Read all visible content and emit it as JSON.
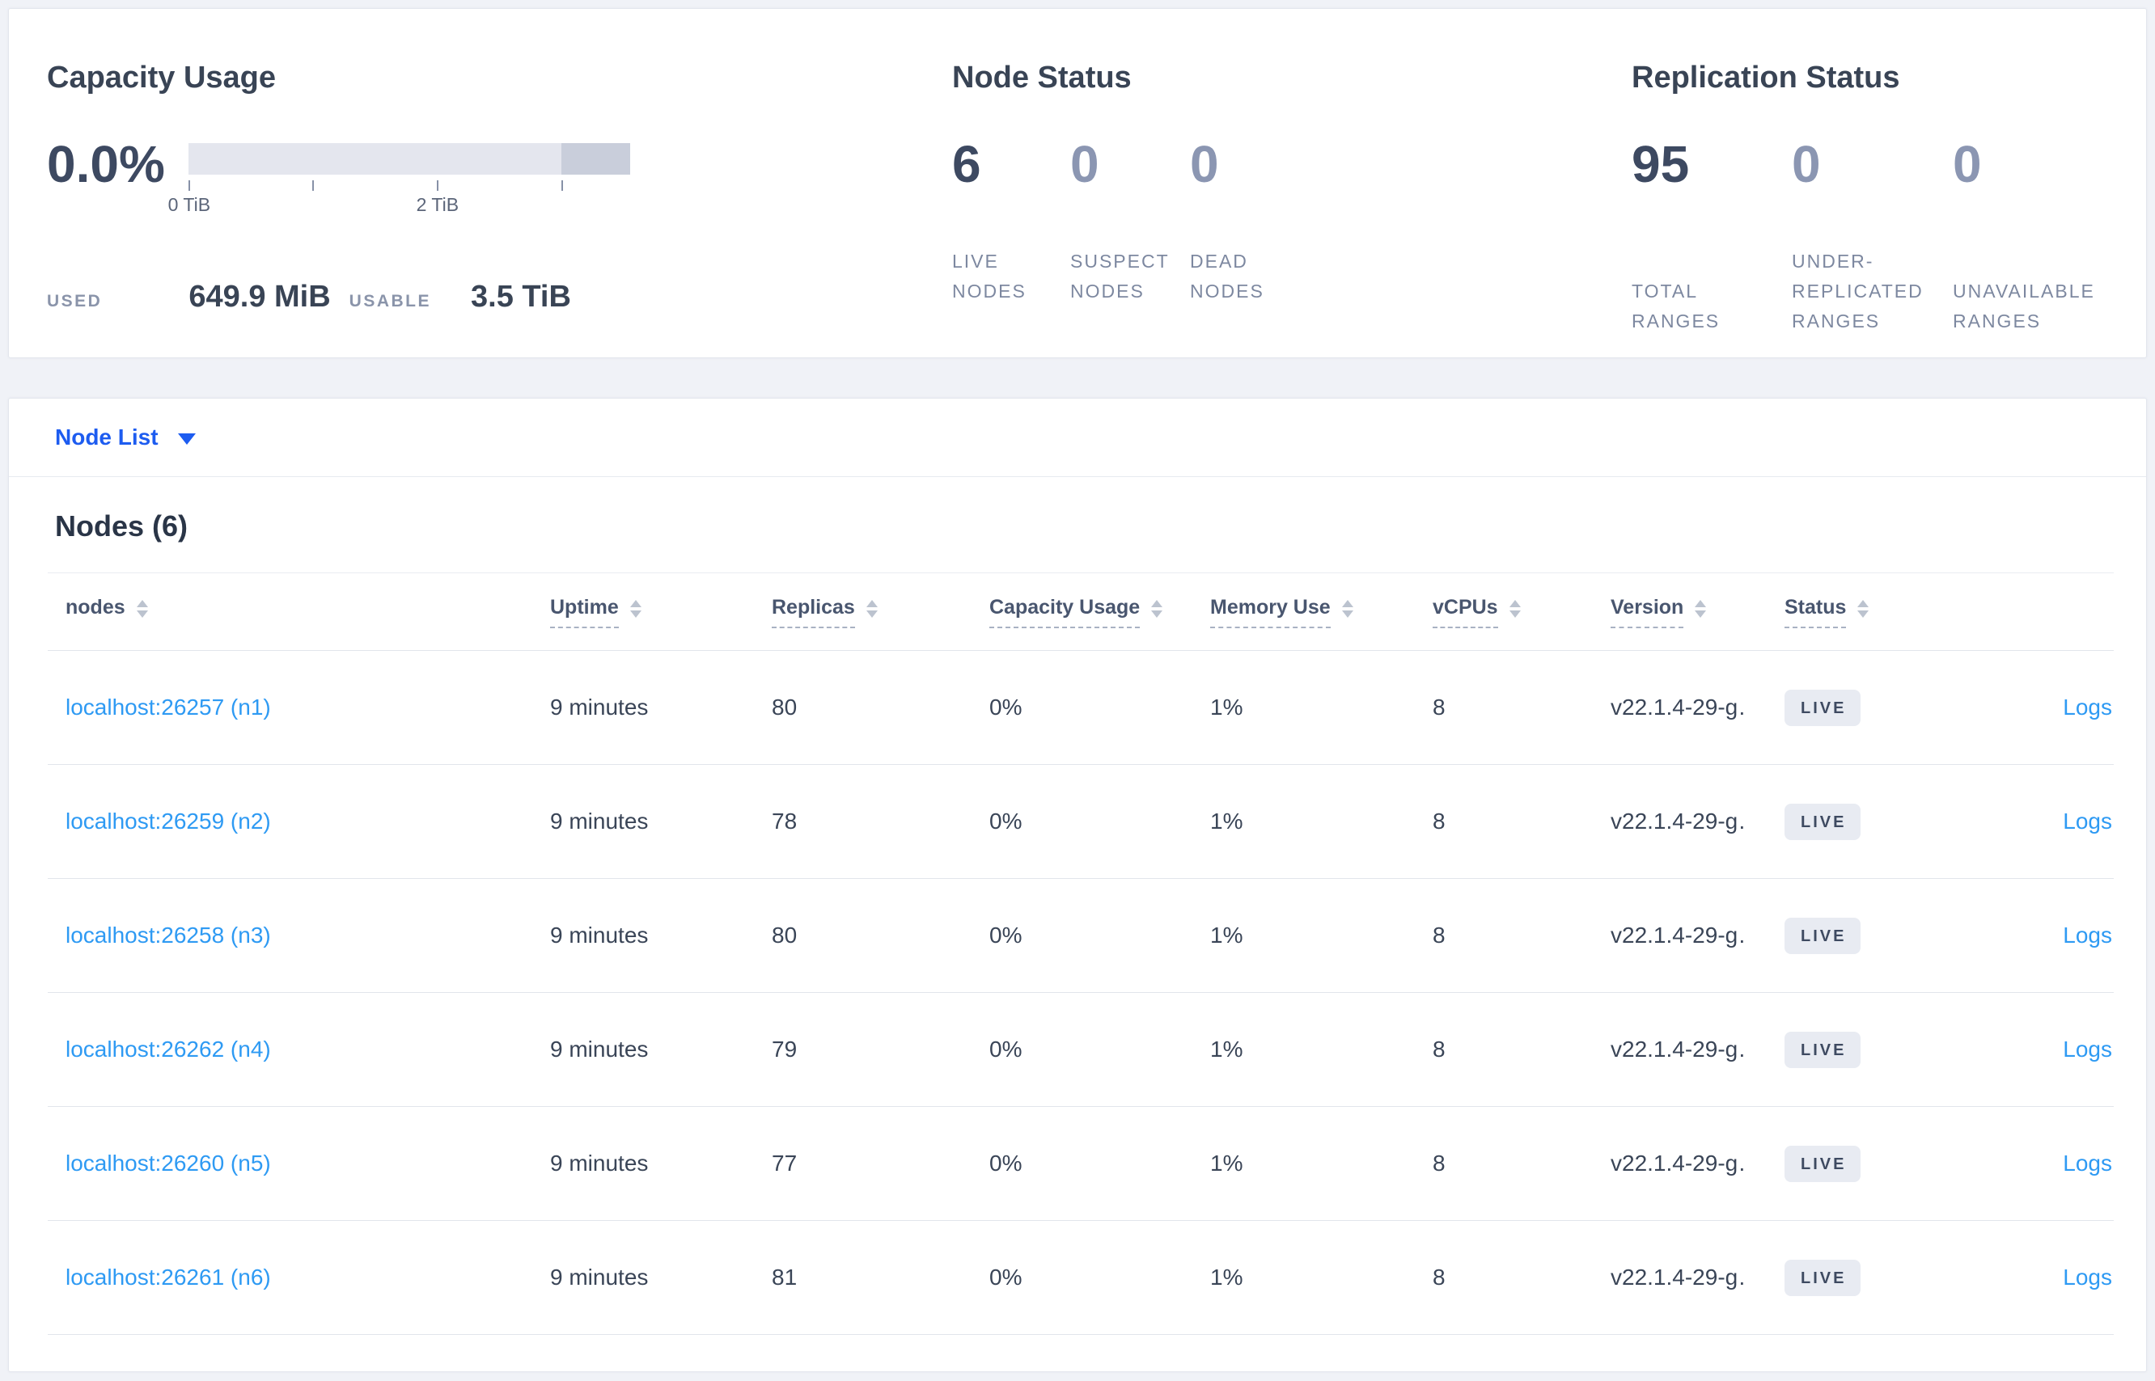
{
  "overview": {
    "capacity": {
      "title": "Capacity Usage",
      "percent": "0.0%",
      "tick_labels": [
        "0 TiB",
        "2 TiB"
      ],
      "used_label": "USED",
      "used_value": "649.9 MiB",
      "usable_label": "USABLE",
      "usable_value": "3.5 TiB"
    },
    "node_status": {
      "title": "Node Status",
      "stats": [
        {
          "value": "6",
          "label": "LIVE NODES"
        },
        {
          "value": "0",
          "label": "SUSPECT NODES"
        },
        {
          "value": "0",
          "label": "DEAD NODES"
        }
      ]
    },
    "replication": {
      "title": "Replication Status",
      "stats": [
        {
          "value": "95",
          "label": "TOTAL RANGES"
        },
        {
          "value": "0",
          "label": "UNDER-REPLICATED RANGES"
        },
        {
          "value": "0",
          "label": "UNAVAILABLE RANGES"
        }
      ]
    }
  },
  "view_selector": {
    "label": "Node List"
  },
  "nodes": {
    "title": "Nodes (6)",
    "columns": {
      "nodes": "nodes",
      "uptime": "Uptime",
      "replicas": "Replicas",
      "capacity": "Capacity Usage",
      "memory": "Memory Use",
      "vcpus": "vCPUs",
      "version": "Version",
      "status": "Status"
    },
    "rows": [
      {
        "address": "localhost:26257 (n1)",
        "uptime": "9 minutes",
        "replicas": "80",
        "capacity": "0%",
        "memory": "1%",
        "vcpus": "8",
        "version": "v22.1.4-29-g…",
        "status": "LIVE",
        "logs": "Logs"
      },
      {
        "address": "localhost:26259 (n2)",
        "uptime": "9 minutes",
        "replicas": "78",
        "capacity": "0%",
        "memory": "1%",
        "vcpus": "8",
        "version": "v22.1.4-29-g…",
        "status": "LIVE",
        "logs": "Logs"
      },
      {
        "address": "localhost:26258 (n3)",
        "uptime": "9 minutes",
        "replicas": "80",
        "capacity": "0%",
        "memory": "1%",
        "vcpus": "8",
        "version": "v22.1.4-29-g…",
        "status": "LIVE",
        "logs": "Logs"
      },
      {
        "address": "localhost:26262 (n4)",
        "uptime": "9 minutes",
        "replicas": "79",
        "capacity": "0%",
        "memory": "1%",
        "vcpus": "8",
        "version": "v22.1.4-29-g…",
        "status": "LIVE",
        "logs": "Logs"
      },
      {
        "address": "localhost:26260 (n5)",
        "uptime": "9 minutes",
        "replicas": "77",
        "capacity": "0%",
        "memory": "1%",
        "vcpus": "8",
        "version": "v22.1.4-29-g…",
        "status": "LIVE",
        "logs": "Logs"
      },
      {
        "address": "localhost:26261 (n6)",
        "uptime": "9 minutes",
        "replicas": "81",
        "capacity": "0%",
        "memory": "1%",
        "vcpus": "8",
        "version": "v22.1.4-29-g…",
        "status": "LIVE",
        "logs": "Logs"
      }
    ]
  },
  "colors": {
    "page_bg": "#f0f2f7",
    "link_blue": "#2e9af3",
    "selector_blue": "#1d5cf0",
    "dark_text": "#394455",
    "muted_stat": "#8b96b2",
    "caps_label": "#7d88a0",
    "badge_bg": "#e8ebf2",
    "bar_light": "#e4e6ee",
    "bar_dark": "#c9cedb",
    "divider": "#e2e5eb"
  }
}
